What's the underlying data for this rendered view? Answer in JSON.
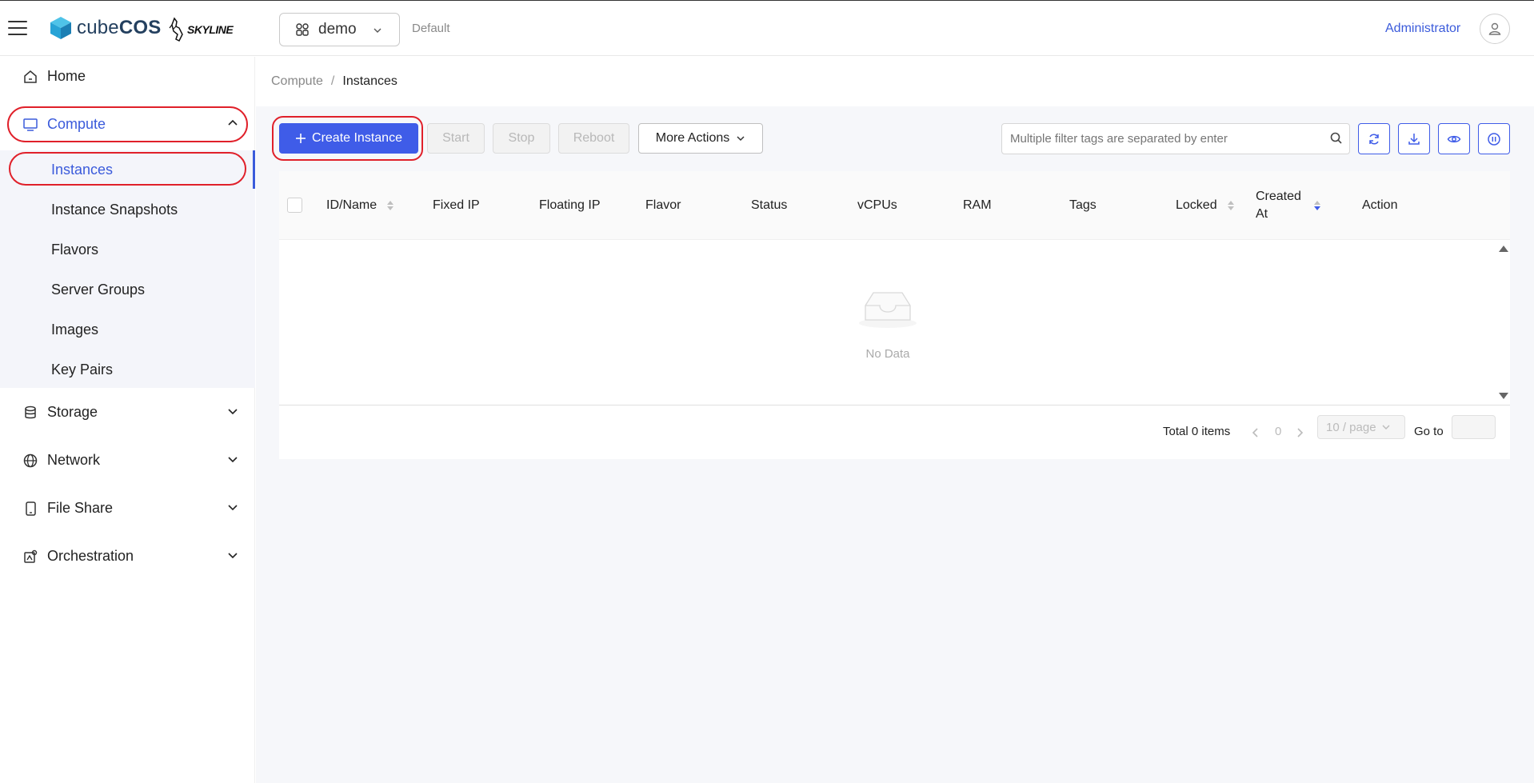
{
  "header": {
    "brand_name_light": "cube",
    "brand_name_bold": "COS",
    "partner_logo": "SKYLINE",
    "project": "demo",
    "domain": "Default",
    "user": "Administrator",
    "icons": [
      "menu-icon",
      "cube-logo-icon",
      "skyline-logo-icon",
      "project-icon",
      "chevron-down-icon",
      "user-icon"
    ]
  },
  "sidebar": {
    "items": [
      {
        "label": "Home",
        "icon": "home-icon"
      },
      {
        "label": "Compute",
        "icon": "monitor-icon",
        "expanded": true
      },
      {
        "label": "Storage",
        "icon": "database-icon"
      },
      {
        "label": "Network",
        "icon": "globe-icon"
      },
      {
        "label": "File Share",
        "icon": "tablet-icon"
      },
      {
        "label": "Orchestration",
        "icon": "orchestration-icon"
      }
    ],
    "compute_subitems": [
      "Instances",
      "Instance Snapshots",
      "Flavors",
      "Server Groups",
      "Images",
      "Key Pairs"
    ],
    "selected": "Instances"
  },
  "breadcrumb": {
    "parent": "Compute",
    "separator": "/",
    "current": "Instances"
  },
  "toolbar": {
    "create": "Create Instance",
    "start": "Start",
    "stop": "Stop",
    "reboot": "Reboot",
    "more": "More Actions",
    "search_placeholder": "Multiple filter tags are separated by enter",
    "icon_buttons": [
      "refresh-icon",
      "download-icon",
      "eye-icon",
      "pause-icon"
    ]
  },
  "table": {
    "columns": [
      "ID/Name",
      "Fixed IP",
      "Floating IP",
      "Flavor",
      "Status",
      "vCPUs",
      "RAM",
      "Tags",
      "Locked",
      "Created At",
      "Action"
    ],
    "rows": [],
    "empty_text": "No Data"
  },
  "pagination": {
    "total": "Total 0 items",
    "current_page": "0",
    "page_size": "10 / page",
    "goto_label": "Go to"
  },
  "colors": {
    "accent": "#3f5ce8",
    "highlight_ring": "#e0202a",
    "submenu_bg": "#f4f5fa"
  }
}
